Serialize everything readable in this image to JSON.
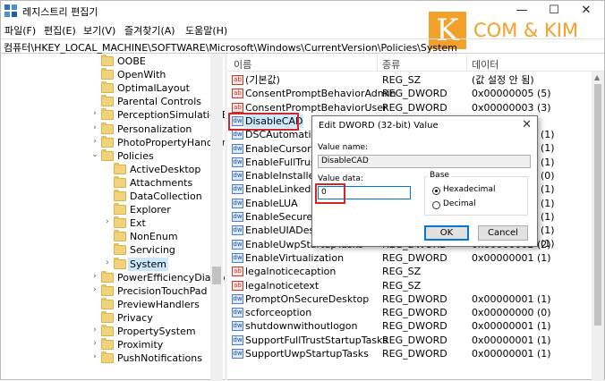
{
  "window": {
    "title": "레지스트리 편집기",
    "minimize": "—",
    "maximize": "☐",
    "close": "✕"
  },
  "menu": [
    "파일(F)",
    "편집(E)",
    "보기(V)",
    "즐겨찾기(A)",
    "도움말(H)"
  ],
  "address": "컴퓨터\\HKEY_LOCAL_MACHINE\\SOFTWARE\\Microsoft\\Windows\\CurrentVersion\\Policies\\System",
  "watermark": {
    "letter": "K",
    "text": "COM & KIM",
    "color": "#f3a12a"
  },
  "tree": [
    {
      "label": "OOBE",
      "level": 1,
      "arrow": ""
    },
    {
      "label": "OpenWith",
      "level": 1,
      "arrow": ""
    },
    {
      "label": "OptimalLayout",
      "level": 1,
      "arrow": ""
    },
    {
      "label": "Parental Controls",
      "level": 1,
      "arrow": ""
    },
    {
      "label": "PerceptionSimulationExten",
      "level": 1,
      "arrow": "›"
    },
    {
      "label": "Personalization",
      "level": 1,
      "arrow": "›"
    },
    {
      "label": "PhotoPropertyHandler",
      "level": 1,
      "arrow": "›"
    },
    {
      "label": "Policies",
      "level": 1,
      "arrow": "⌄"
    },
    {
      "label": "ActiveDesktop",
      "level": 2,
      "arrow": ""
    },
    {
      "label": "Attachments",
      "level": 2,
      "arrow": ""
    },
    {
      "label": "DataCollection",
      "level": 2,
      "arrow": ""
    },
    {
      "label": "Explorer",
      "level": 2,
      "arrow": ""
    },
    {
      "label": "Ext",
      "level": 2,
      "arrow": "›"
    },
    {
      "label": "NonEnum",
      "level": 2,
      "arrow": ""
    },
    {
      "label": "Servicing",
      "level": 2,
      "arrow": ""
    },
    {
      "label": "System",
      "level": 2,
      "arrow": "›",
      "selected": true
    },
    {
      "label": "PowerEfficiencyDiagnostic",
      "level": 1,
      "arrow": "›"
    },
    {
      "label": "PrecisionTouchPad",
      "level": 1,
      "arrow": "›"
    },
    {
      "label": "PreviewHandlers",
      "level": 1,
      "arrow": ""
    },
    {
      "label": "Privacy",
      "level": 1,
      "arrow": ""
    },
    {
      "label": "PropertySystem",
      "level": 1,
      "arrow": "›"
    },
    {
      "label": "Proximity",
      "level": 1,
      "arrow": "›"
    },
    {
      "label": "PushNotifications",
      "level": 1,
      "arrow": "›"
    }
  ],
  "list": {
    "headers": {
      "name": "이름",
      "type": "종류",
      "data": "데이터"
    },
    "rows": [
      {
        "icon": "ab",
        "name": "(기본값)",
        "type": "REG_SZ",
        "data": "(값 설정 안 됨)"
      },
      {
        "icon": "ab",
        "name": "ConsentPromptBehaviorAdmin",
        "type": "REG_DWORD",
        "data": "0x00000005 (5)"
      },
      {
        "icon": "ab",
        "name": "ConsentPromptBehaviorUser",
        "type": "REG_DWORD",
        "data": "0x00000003 (3)"
      },
      {
        "icon": "dw",
        "name": "DisableCAD",
        "type": "",
        "data": "",
        "selected": true
      },
      {
        "icon": "dw",
        "name": "DSCAutomation",
        "type": "",
        "data": ""
      },
      {
        "icon": "dw",
        "name": "EnableCursorSup",
        "type": "",
        "data": ""
      },
      {
        "icon": "dw",
        "name": "EnableFullTrustS",
        "type": "",
        "data": ""
      },
      {
        "icon": "dw",
        "name": "EnableInstallerD",
        "type": "",
        "data": ""
      },
      {
        "icon": "dw",
        "name": "EnableLinkedCo",
        "type": "",
        "data": ""
      },
      {
        "icon": "dw",
        "name": "EnableLUA",
        "type": "",
        "data": ""
      },
      {
        "icon": "dw",
        "name": "EnableSecureUIA",
        "type": "",
        "data": ""
      },
      {
        "icon": "dw",
        "name": "EnableUIADeskto",
        "type": "",
        "data": ""
      },
      {
        "icon": "dw",
        "name": "EnableUwpStartupTasks",
        "type": "REG_DWORD",
        "data": "0x00000002 (2)"
      },
      {
        "icon": "dw",
        "name": "EnableVirtualization",
        "type": "REG_DWORD",
        "data": "0x00000001 (1)"
      },
      {
        "icon": "ab",
        "name": "legalnoticecaption",
        "type": "REG_SZ",
        "data": ""
      },
      {
        "icon": "ab",
        "name": "legalnoticetext",
        "type": "REG_SZ",
        "data": ""
      },
      {
        "icon": "dw",
        "name": "PromptOnSecureDesktop",
        "type": "REG_DWORD",
        "data": "0x00000001 (1)"
      },
      {
        "icon": "dw",
        "name": "scforceoption",
        "type": "REG_DWORD",
        "data": "0x00000000 (0)"
      },
      {
        "icon": "dw",
        "name": "shutdownwithoutlogon",
        "type": "REG_DWORD",
        "data": "0x00000001 (1)"
      },
      {
        "icon": "dw",
        "name": "SupportFullTrustStartupTasks",
        "type": "REG_DWORD",
        "data": "0x00000001 (1)"
      },
      {
        "icon": "dw",
        "name": "SupportUwpStartupTasks",
        "type": "REG_DWORD",
        "data": "0x00000001 (1)"
      }
    ],
    "partial_right_values": [
      "(1)",
      "(1)",
      "(1)",
      "(0)",
      "(1)",
      "(1)",
      "(1)",
      "(1)",
      "(1)"
    ]
  },
  "dialog": {
    "title": "Edit DWORD (32-bit) Value",
    "close": "✕",
    "value_name_label": "Value name:",
    "value_name": "DisableCAD",
    "value_data_label": "Value data:",
    "value_data": "0",
    "base_label": "Base",
    "hex_label": "Hexadecimal",
    "dec_label": "Decimal",
    "ok": "OK",
    "cancel": "Cancel"
  },
  "colors": {
    "highlight": "#d32727",
    "selection": "#cce8ff",
    "focus": "#0078d7"
  }
}
